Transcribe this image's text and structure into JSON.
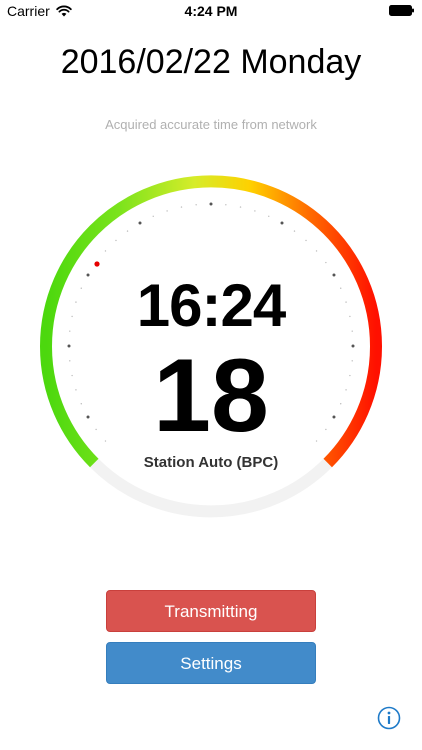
{
  "status_bar": {
    "carrier": "Carrier",
    "time": "4:24 PM",
    "wifi_icon": "wifi-icon",
    "battery_icon": "battery-icon"
  },
  "header": {
    "date": "2016/02/22 Monday",
    "status": "Acquired accurate time from network"
  },
  "dial": {
    "time": "16:24",
    "seconds": "18",
    "station": "Station Auto (BPC)",
    "gradient_colors": [
      "#66dd22",
      "#ffdd00",
      "#ff2200"
    ],
    "track_color": "#f0f0f0",
    "marker_color": "#e60000"
  },
  "buttons": {
    "transmit_label": "Transmitting",
    "settings_label": "Settings",
    "transmit_color": "#d9534f",
    "settings_color": "#428bca"
  },
  "footer": {
    "info_icon": "info-icon",
    "accent": "#1e7ac8"
  }
}
